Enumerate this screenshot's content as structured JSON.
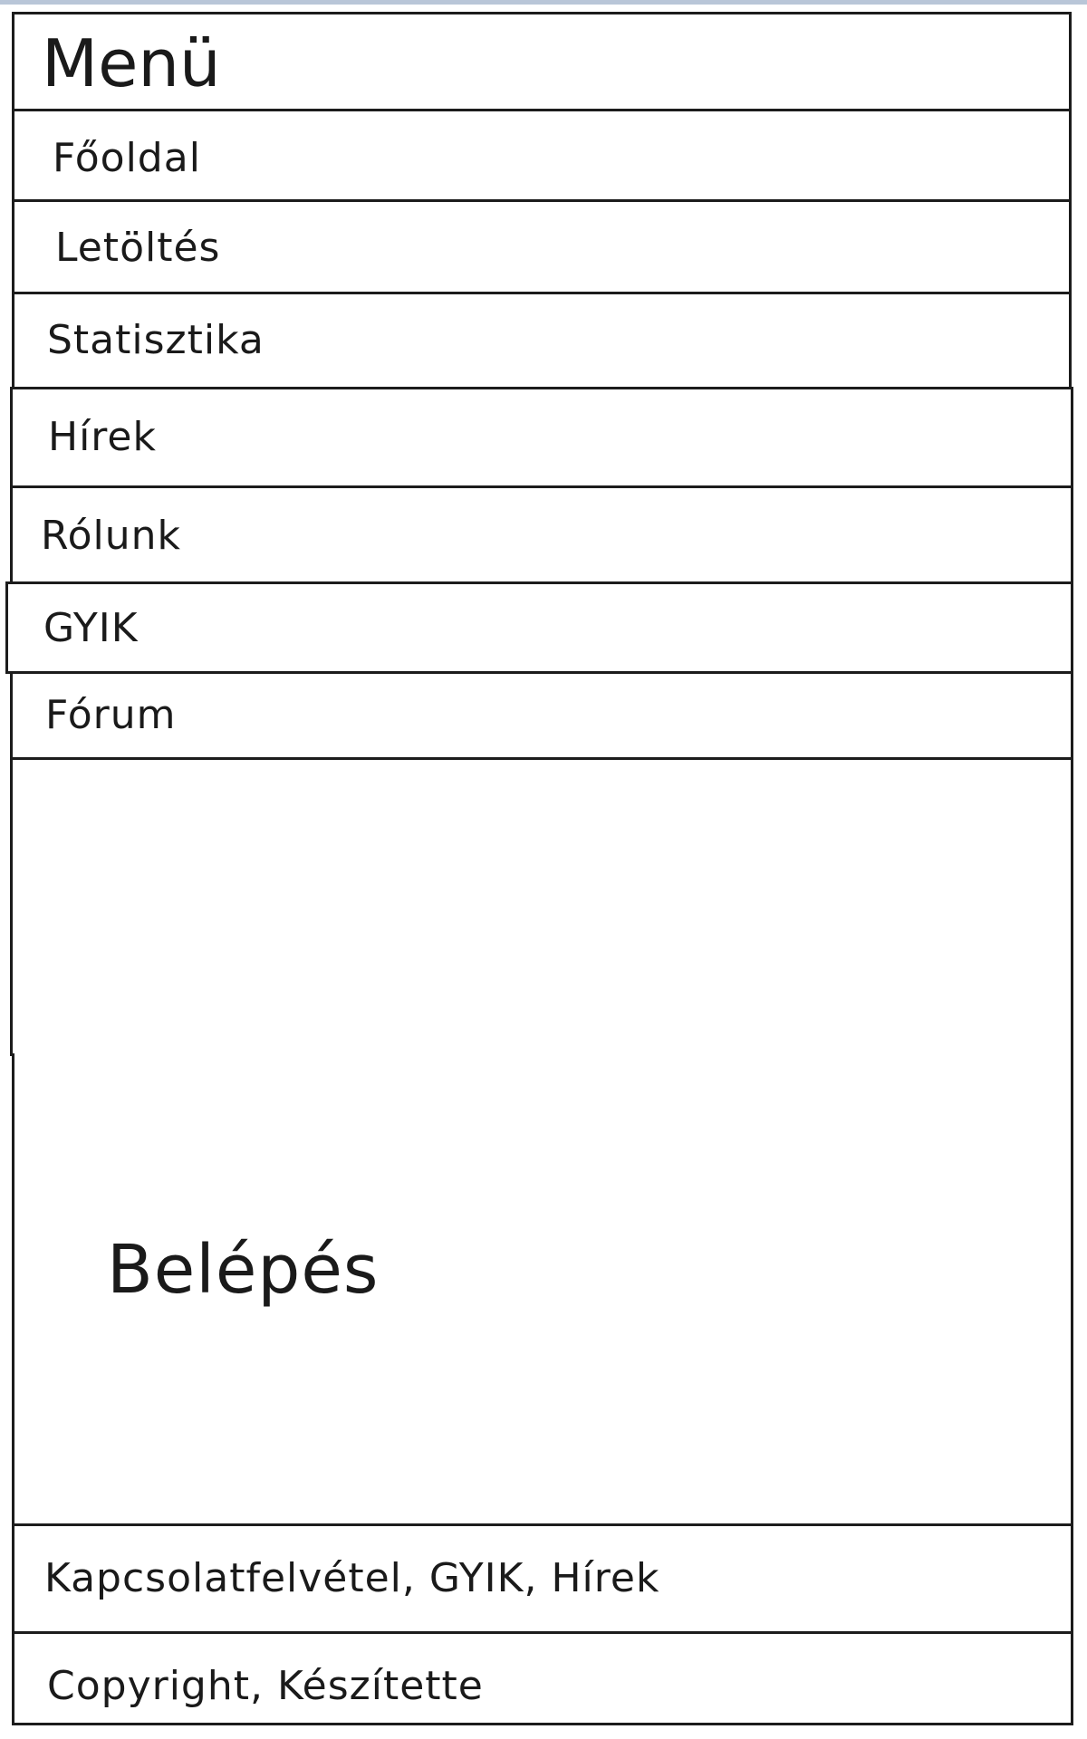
{
  "header": {
    "title": "Menü"
  },
  "menu": {
    "items": [
      {
        "label": "Főoldal"
      },
      {
        "label": "Letöltés"
      },
      {
        "label": "Statisztika"
      },
      {
        "label": "Hírek"
      },
      {
        "label": "Rólunk"
      },
      {
        "label": "GYIK"
      },
      {
        "label": "Fórum"
      }
    ]
  },
  "login": {
    "label": "Belépés"
  },
  "footer": {
    "links_text": "Kapcsolatfelvétel, GYIK, Hírek",
    "copyright_text": "Copyright, Készítette"
  }
}
